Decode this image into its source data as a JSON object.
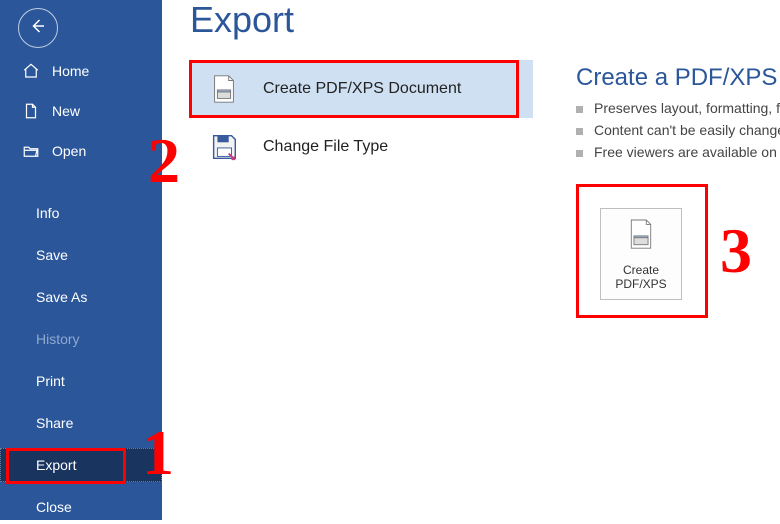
{
  "page_title": "Export",
  "back_icon": "back-arrow",
  "nav_top": [
    {
      "key": "home",
      "label": "Home",
      "icon": "home-icon"
    },
    {
      "key": "new",
      "label": "New",
      "icon": "file-icon"
    },
    {
      "key": "open",
      "label": "Open",
      "icon": "folder-open-icon"
    }
  ],
  "nav_sub": [
    {
      "key": "info",
      "label": "Info"
    },
    {
      "key": "save",
      "label": "Save"
    },
    {
      "key": "saveas",
      "label": "Save As"
    },
    {
      "key": "history",
      "label": "History",
      "muted": true
    },
    {
      "key": "print",
      "label": "Print"
    },
    {
      "key": "share",
      "label": "Share"
    },
    {
      "key": "export",
      "label": "Export",
      "selected": true
    },
    {
      "key": "close",
      "label": "Close"
    }
  ],
  "export_options": [
    {
      "key": "pdfxps",
      "label": "Create PDF/XPS Document",
      "icon": "pdf-file-icon",
      "selected": true
    },
    {
      "key": "filetype",
      "label": "Change File Type",
      "icon": "save-as-icon",
      "selected": false
    }
  ],
  "detail": {
    "title": "Create a PDF/XPS Document",
    "bullets": [
      "Preserves layout, formatting, fonts, and images",
      "Content can't be easily changed",
      "Free viewers are available on the web"
    ],
    "button": {
      "line1": "Create",
      "line2": "PDF/XPS",
      "icon": "pdf-file-icon"
    }
  },
  "annotations": {
    "n1": "1",
    "n2": "2",
    "n3": "3"
  },
  "colors": {
    "brand": "#2b579a",
    "selected_sidebar": "#19355f",
    "selected_option": "#cfe0f3",
    "annotation": "#ff0000"
  }
}
